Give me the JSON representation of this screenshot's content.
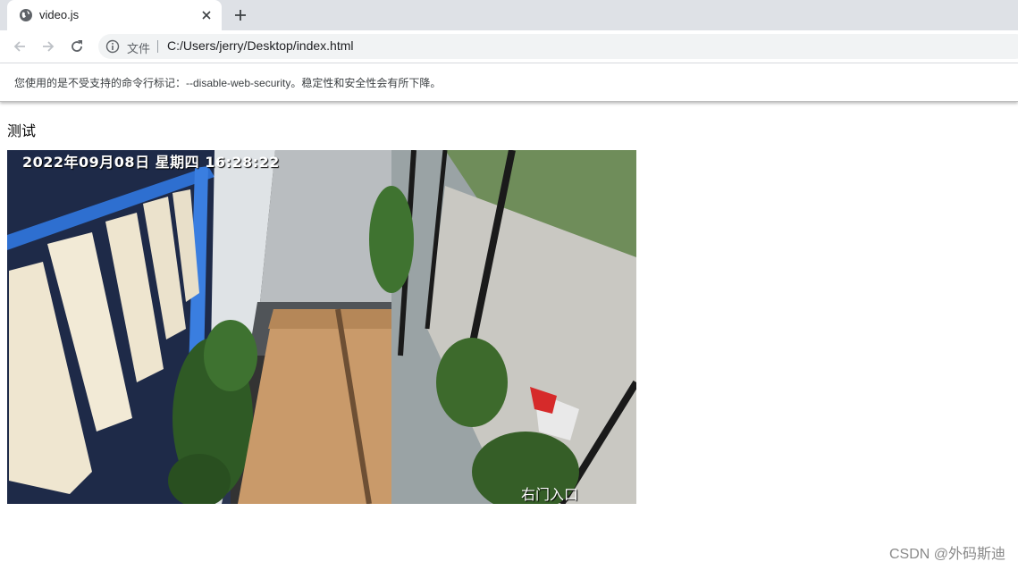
{
  "tab": {
    "title": "video.js"
  },
  "toolbar": {
    "scheme_label": "文件",
    "url": "C:/Users/jerry/Desktop/index.html"
  },
  "infobar": {
    "message": "您使用的是不受支持的命令行标记：--disable-web-security。稳定性和安全性会有所下降。"
  },
  "page": {
    "heading": "测试",
    "video": {
      "osd_timestamp": "2022年09月08日  星期四  16:28:22",
      "osd_label": "右门入口"
    }
  },
  "watermark": "CSDN @外码斯迪",
  "colors": {
    "tabstrip_bg": "#dee1e6",
    "omnibox_bg": "#f1f3f4",
    "icon": "#5f6368"
  },
  "icons": [
    "globe-icon",
    "close-icon",
    "plus-icon",
    "arrow-left-icon",
    "arrow-right-icon",
    "reload-icon",
    "info-icon"
  ]
}
